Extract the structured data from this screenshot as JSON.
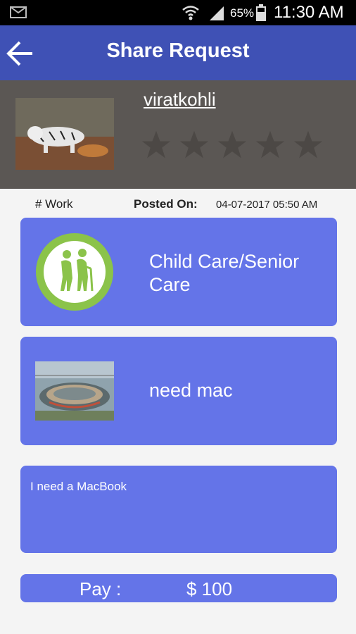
{
  "status_bar": {
    "battery_percent": "65%",
    "time": "11:30 AM",
    "icons": [
      "mail-icon",
      "wifi-icon",
      "signal-icon",
      "battery-icon"
    ]
  },
  "app_bar": {
    "title": "Share Request",
    "back_icon": "arrow-left-icon"
  },
  "profile": {
    "username": "viratkohli",
    "avatar": "white tiger photo",
    "rating": 0,
    "rating_max": 5
  },
  "meta": {
    "tag": "# Work",
    "posted_on_label": "Posted On:",
    "posted_on_value": "04-07-2017 05:50 AM"
  },
  "category": {
    "icon": "senior-couple-icon",
    "label": "Child Care/Senior Care"
  },
  "item": {
    "thumbnail": "photo thumbnail",
    "title": "need mac"
  },
  "description": "I need a MacBook",
  "pay": {
    "label": "Pay :",
    "value": "$ 100"
  },
  "colors": {
    "app_bar": "#3f51b5",
    "profile_bg": "#5b5754",
    "card": "#6474e8",
    "category_icon": "#8bc34a"
  }
}
